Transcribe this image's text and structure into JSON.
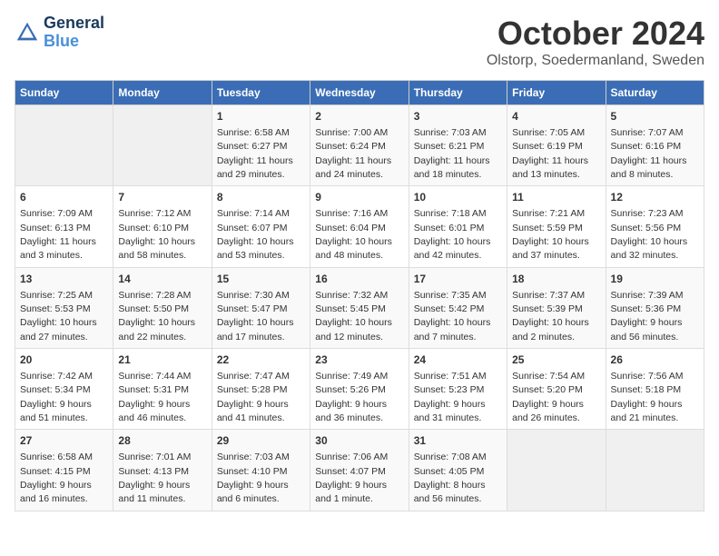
{
  "logo": {
    "line1": "General",
    "line2": "Blue"
  },
  "title": "October 2024",
  "subtitle": "Olstorp, Soedermanland, Sweden",
  "days_of_week": [
    "Sunday",
    "Monday",
    "Tuesday",
    "Wednesday",
    "Thursday",
    "Friday",
    "Saturday"
  ],
  "weeks": [
    [
      {
        "day": "",
        "sunrise": "",
        "sunset": "",
        "daylight": "",
        "empty": true
      },
      {
        "day": "",
        "sunrise": "",
        "sunset": "",
        "daylight": "",
        "empty": true
      },
      {
        "day": "1",
        "sunrise": "Sunrise: 6:58 AM",
        "sunset": "Sunset: 6:27 PM",
        "daylight": "Daylight: 11 hours and 29 minutes."
      },
      {
        "day": "2",
        "sunrise": "Sunrise: 7:00 AM",
        "sunset": "Sunset: 6:24 PM",
        "daylight": "Daylight: 11 hours and 24 minutes."
      },
      {
        "day": "3",
        "sunrise": "Sunrise: 7:03 AM",
        "sunset": "Sunset: 6:21 PM",
        "daylight": "Daylight: 11 hours and 18 minutes."
      },
      {
        "day": "4",
        "sunrise": "Sunrise: 7:05 AM",
        "sunset": "Sunset: 6:19 PM",
        "daylight": "Daylight: 11 hours and 13 minutes."
      },
      {
        "day": "5",
        "sunrise": "Sunrise: 7:07 AM",
        "sunset": "Sunset: 6:16 PM",
        "daylight": "Daylight: 11 hours and 8 minutes."
      }
    ],
    [
      {
        "day": "6",
        "sunrise": "Sunrise: 7:09 AM",
        "sunset": "Sunset: 6:13 PM",
        "daylight": "Daylight: 11 hours and 3 minutes."
      },
      {
        "day": "7",
        "sunrise": "Sunrise: 7:12 AM",
        "sunset": "Sunset: 6:10 PM",
        "daylight": "Daylight: 10 hours and 58 minutes."
      },
      {
        "day": "8",
        "sunrise": "Sunrise: 7:14 AM",
        "sunset": "Sunset: 6:07 PM",
        "daylight": "Daylight: 10 hours and 53 minutes."
      },
      {
        "day": "9",
        "sunrise": "Sunrise: 7:16 AM",
        "sunset": "Sunset: 6:04 PM",
        "daylight": "Daylight: 10 hours and 48 minutes."
      },
      {
        "day": "10",
        "sunrise": "Sunrise: 7:18 AM",
        "sunset": "Sunset: 6:01 PM",
        "daylight": "Daylight: 10 hours and 42 minutes."
      },
      {
        "day": "11",
        "sunrise": "Sunrise: 7:21 AM",
        "sunset": "Sunset: 5:59 PM",
        "daylight": "Daylight: 10 hours and 37 minutes."
      },
      {
        "day": "12",
        "sunrise": "Sunrise: 7:23 AM",
        "sunset": "Sunset: 5:56 PM",
        "daylight": "Daylight: 10 hours and 32 minutes."
      }
    ],
    [
      {
        "day": "13",
        "sunrise": "Sunrise: 7:25 AM",
        "sunset": "Sunset: 5:53 PM",
        "daylight": "Daylight: 10 hours and 27 minutes."
      },
      {
        "day": "14",
        "sunrise": "Sunrise: 7:28 AM",
        "sunset": "Sunset: 5:50 PM",
        "daylight": "Daylight: 10 hours and 22 minutes."
      },
      {
        "day": "15",
        "sunrise": "Sunrise: 7:30 AM",
        "sunset": "Sunset: 5:47 PM",
        "daylight": "Daylight: 10 hours and 17 minutes."
      },
      {
        "day": "16",
        "sunrise": "Sunrise: 7:32 AM",
        "sunset": "Sunset: 5:45 PM",
        "daylight": "Daylight: 10 hours and 12 minutes."
      },
      {
        "day": "17",
        "sunrise": "Sunrise: 7:35 AM",
        "sunset": "Sunset: 5:42 PM",
        "daylight": "Daylight: 10 hours and 7 minutes."
      },
      {
        "day": "18",
        "sunrise": "Sunrise: 7:37 AM",
        "sunset": "Sunset: 5:39 PM",
        "daylight": "Daylight: 10 hours and 2 minutes."
      },
      {
        "day": "19",
        "sunrise": "Sunrise: 7:39 AM",
        "sunset": "Sunset: 5:36 PM",
        "daylight": "Daylight: 9 hours and 56 minutes."
      }
    ],
    [
      {
        "day": "20",
        "sunrise": "Sunrise: 7:42 AM",
        "sunset": "Sunset: 5:34 PM",
        "daylight": "Daylight: 9 hours and 51 minutes."
      },
      {
        "day": "21",
        "sunrise": "Sunrise: 7:44 AM",
        "sunset": "Sunset: 5:31 PM",
        "daylight": "Daylight: 9 hours and 46 minutes."
      },
      {
        "day": "22",
        "sunrise": "Sunrise: 7:47 AM",
        "sunset": "Sunset: 5:28 PM",
        "daylight": "Daylight: 9 hours and 41 minutes."
      },
      {
        "day": "23",
        "sunrise": "Sunrise: 7:49 AM",
        "sunset": "Sunset: 5:26 PM",
        "daylight": "Daylight: 9 hours and 36 minutes."
      },
      {
        "day": "24",
        "sunrise": "Sunrise: 7:51 AM",
        "sunset": "Sunset: 5:23 PM",
        "daylight": "Daylight: 9 hours and 31 minutes."
      },
      {
        "day": "25",
        "sunrise": "Sunrise: 7:54 AM",
        "sunset": "Sunset: 5:20 PM",
        "daylight": "Daylight: 9 hours and 26 minutes."
      },
      {
        "day": "26",
        "sunrise": "Sunrise: 7:56 AM",
        "sunset": "Sunset: 5:18 PM",
        "daylight": "Daylight: 9 hours and 21 minutes."
      }
    ],
    [
      {
        "day": "27",
        "sunrise": "Sunrise: 6:58 AM",
        "sunset": "Sunset: 4:15 PM",
        "daylight": "Daylight: 9 hours and 16 minutes."
      },
      {
        "day": "28",
        "sunrise": "Sunrise: 7:01 AM",
        "sunset": "Sunset: 4:13 PM",
        "daylight": "Daylight: 9 hours and 11 minutes."
      },
      {
        "day": "29",
        "sunrise": "Sunrise: 7:03 AM",
        "sunset": "Sunset: 4:10 PM",
        "daylight": "Daylight: 9 hours and 6 minutes."
      },
      {
        "day": "30",
        "sunrise": "Sunrise: 7:06 AM",
        "sunset": "Sunset: 4:07 PM",
        "daylight": "Daylight: 9 hours and 1 minute."
      },
      {
        "day": "31",
        "sunrise": "Sunrise: 7:08 AM",
        "sunset": "Sunset: 4:05 PM",
        "daylight": "Daylight: 8 hours and 56 minutes."
      },
      {
        "day": "",
        "sunrise": "",
        "sunset": "",
        "daylight": "",
        "empty": true
      },
      {
        "day": "",
        "sunrise": "",
        "sunset": "",
        "daylight": "",
        "empty": true
      }
    ]
  ]
}
